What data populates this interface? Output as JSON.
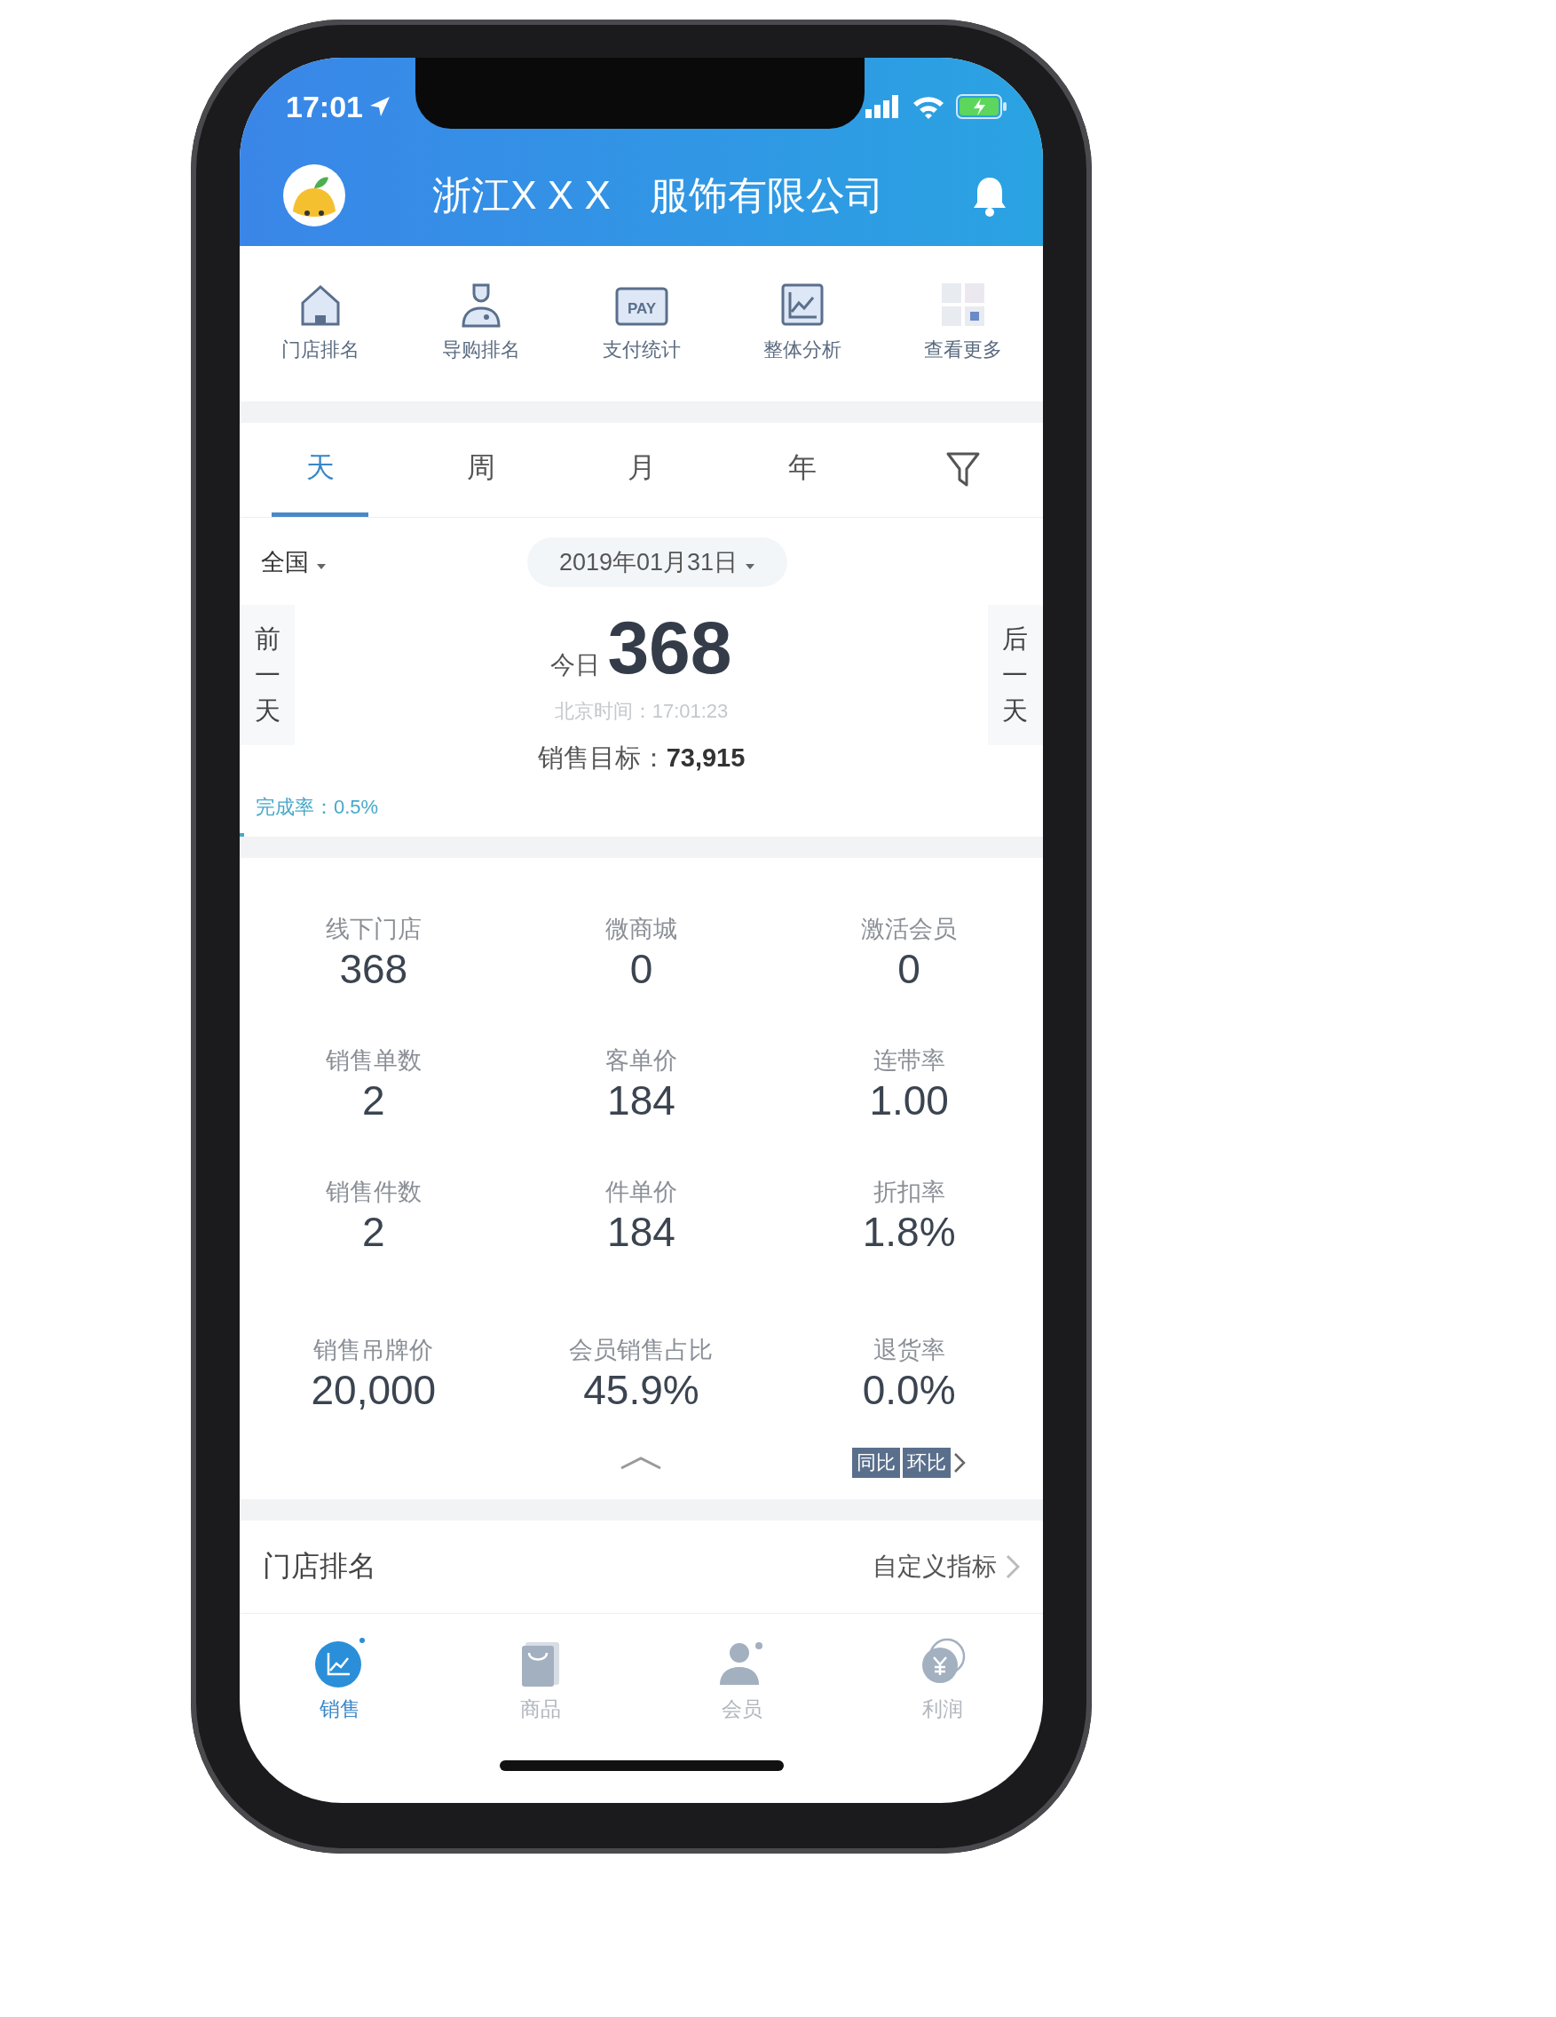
{
  "status_bar": {
    "time": "17:01"
  },
  "header": {
    "title": "浙江X X X　服饰有限公司"
  },
  "shortcuts": [
    {
      "label": "门店排名"
    },
    {
      "label": "导购排名"
    },
    {
      "label": "支付统计",
      "icon_text": "PAY"
    },
    {
      "label": "整体分析"
    },
    {
      "label": "查看更多"
    }
  ],
  "period_tabs": [
    {
      "label": "天",
      "selected": true
    },
    {
      "label": "周",
      "selected": false
    },
    {
      "label": "月",
      "selected": false
    },
    {
      "label": "年",
      "selected": false
    }
  ],
  "filters": {
    "region": "全国",
    "date": "2019年01月31日"
  },
  "day_nav": {
    "previous": "前一天",
    "next": "后一天"
  },
  "summary": {
    "prefix": "今日",
    "value": "368",
    "time": "北京时间：17:01:23",
    "target_label": "销售目标：",
    "target_value": "73,915",
    "completion": "完成率：0.5%",
    "level": 0.005
  },
  "stats": [
    {
      "label": "线下门店",
      "value": "368"
    },
    {
      "label": "微商城",
      "value": "0"
    },
    {
      "label": "激活会员",
      "value": "0"
    },
    {
      "label": "销售单数",
      "value": "2"
    },
    {
      "label": "客单价",
      "value": "184"
    },
    {
      "label": "连带率",
      "value": "1.00"
    },
    {
      "label": "销售件数",
      "value": "2"
    },
    {
      "label": "件单价",
      "value": "184"
    },
    {
      "label": "折扣率",
      "value": "1.8%"
    },
    {
      "label": "销售吊牌价",
      "value": "20,000"
    },
    {
      "label": "会员销售占比",
      "value": "45.9%"
    },
    {
      "label": "退货率",
      "value": "0.0%"
    }
  ],
  "compare_buttons": [
    "同比",
    "环比"
  ],
  "ranking": {
    "title": "门店排名",
    "link": "自定义指标"
  },
  "bottom_nav": [
    {
      "label": "销售",
      "selected": true
    },
    {
      "label": "商品",
      "selected": false
    },
    {
      "label": "会员",
      "selected": false
    },
    {
      "label": "利润",
      "selected": false
    }
  ]
}
